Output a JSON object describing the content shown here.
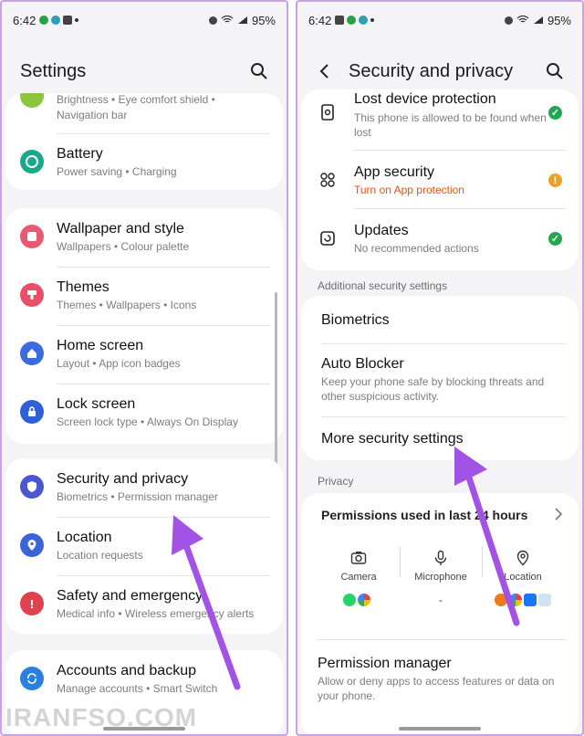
{
  "left": {
    "status": {
      "time": "6:42",
      "battery": "95%"
    },
    "header": {
      "title": "Settings"
    },
    "top_partial": {
      "subtitle_a": "Brightness  •  Eye comfort shield  •",
      "subtitle_b": "Navigation bar"
    },
    "items": [
      {
        "label": "Battery",
        "sub": "Power saving  •  Charging",
        "color": "#1aa88a"
      },
      {
        "label": "Wallpaper and style",
        "sub": "Wallpapers  •  Colour palette",
        "color": "#e85a73"
      },
      {
        "label": "Themes",
        "sub": "Themes  •  Wallpapers  •  Icons",
        "color": "#e8506a"
      },
      {
        "label": "Home screen",
        "sub": "Layout  •  App icon badges",
        "color": "#3a6be0"
      },
      {
        "label": "Lock screen",
        "sub": "Screen lock type  •  Always On Display",
        "color": "#2f5fd6"
      },
      {
        "label": "Security and privacy",
        "sub": "Biometrics  •  Permission manager",
        "color": "#4a58cf"
      },
      {
        "label": "Location",
        "sub": "Location requests",
        "color": "#3b64d8"
      },
      {
        "label": "Safety and emergency",
        "sub": "Medical info  •  Wireless emergency alerts",
        "color": "#e0414f"
      },
      {
        "label": "Accounts and backup",
        "sub": "Manage accounts  •  Smart Switch",
        "color": "#2a7fe0"
      }
    ]
  },
  "right": {
    "status": {
      "time": "6:42",
      "battery": "95%"
    },
    "header": {
      "title": "Security and privacy"
    },
    "rows": [
      {
        "label": "Lost device protection",
        "sub": "This phone is allowed to be found when lost"
      },
      {
        "label": "App security",
        "sub": "Turn on App protection"
      },
      {
        "label": "Updates",
        "sub": "No recommended actions"
      }
    ],
    "additional_label": "Additional security settings",
    "biometrics": "Biometrics",
    "auto_blocker": {
      "label": "Auto Blocker",
      "sub_a": "Keep your phone safe by blocking threats and",
      "sub_b": "other suspicious activity."
    },
    "more_security": "More security settings",
    "privacy_label": "Privacy",
    "permissions": {
      "title": "Permissions used in last 24 hours",
      "camera": "Camera",
      "microphone": "Microphone",
      "location": "Location",
      "dash": "-"
    },
    "permission_manager": {
      "label": "Permission manager",
      "sub_a": "Allow or deny apps to access features or data on",
      "sub_b": "your phone."
    }
  },
  "watermark": "IRANFSO.COM",
  "colors": {
    "accent": "#a352e6",
    "ok": "#1fa84f",
    "warn": "#f0a020",
    "warn_text": "#e0571a"
  }
}
